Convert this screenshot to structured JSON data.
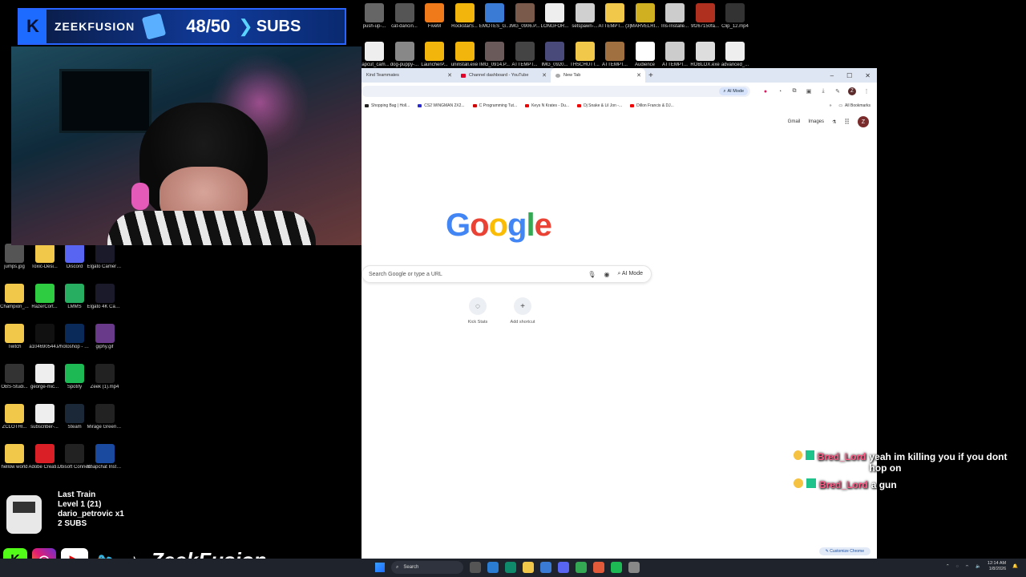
{
  "overlay": {
    "logo_letter": "K",
    "channel": "ZEEKFUSION",
    "sub_goal": "48/50",
    "subs_label": "SUBS"
  },
  "desktop_top_icons": [
    {
      "label": "push-up-...",
      "color": "#666"
    },
    {
      "label": "cat-dancin...",
      "color": "#555"
    },
    {
      "label": "FiveM",
      "color": "#f07a1a"
    },
    {
      "label": "RockstarS...",
      "color": "#f2b50c"
    },
    {
      "label": "EMOTES_G...",
      "color": "#3a7bd5"
    },
    {
      "label": "IMG_0906.P...",
      "color": "#7a5a4a"
    },
    {
      "label": "LONGFOR...",
      "color": "#eee"
    },
    {
      "label": "setspawn-...",
      "color": "#d0d0d0"
    },
    {
      "label": "ATTEMPT... (3)",
      "color": "#f2c84b"
    },
    {
      "label": "MARVELRI...",
      "color": "#d0b020"
    },
    {
      "label": "Iris-Installe...",
      "color": "#ccc"
    },
    {
      "label": "9f267150fa...",
      "color": "#b03020"
    },
    {
      "label": "Clip_12.mp4",
      "color": "#333"
    }
  ],
  "desktop_top_icons_row2": [
    {
      "label": "capcut_cam...",
      "color": "#eee"
    },
    {
      "label": "dog-puppy-...",
      "color": "#888"
    },
    {
      "label": "LauncherP...",
      "color": "#f2b50c"
    },
    {
      "label": "uninstall.exe",
      "color": "#f2b50c"
    },
    {
      "label": "IMG_0914.P...",
      "color": "#6a5a5a"
    },
    {
      "label": "ATTEMPT...",
      "color": "#444"
    },
    {
      "label": "IMG_0920...",
      "color": "#4a4a7a"
    },
    {
      "label": "THSCHUTT...",
      "color": "#f2c84b"
    },
    {
      "label": "ATTEMPT...",
      "color": "#a07040"
    },
    {
      "label": "Audience",
      "color": "#fff"
    },
    {
      "label": "ATTEMPT...",
      "color": "#ccc"
    },
    {
      "label": "ROBLOX.exe",
      "color": "#ddd"
    },
    {
      "label": "advanced_...",
      "color": "#eee"
    }
  ],
  "desktop_left_icons": [
    [
      {
        "label": "jumps.jpg",
        "color": "#555"
      },
      {
        "label": "Toxic-Desi...",
        "color": "#f2c84b"
      },
      {
        "label": "Discord",
        "color": "#5865f2"
      },
      {
        "label": "Elgato Camera Hub",
        "color": "#1a1a2a"
      }
    ],
    [
      {
        "label": "Champion_...",
        "color": "#f2c84b"
      },
      {
        "label": "RazerCort...",
        "color": "#2ecc40"
      },
      {
        "label": "LMMS",
        "color": "#27ae60"
      },
      {
        "label": "Elgato 4K Captur...",
        "color": "#1a1a2a"
      }
    ],
    [
      {
        "label": "Twitch",
        "color": "#f2c84b"
      },
      {
        "label": "a104690544...",
        "color": "#111"
      },
      {
        "label": "Photoshop - Shortcut",
        "color": "#0a2a5a"
      },
      {
        "label": "giphy.gif",
        "color": "#6a3a8a"
      }
    ],
    [
      {
        "label": "OBS-Studi...",
        "color": "#333"
      },
      {
        "label": "george-mic...",
        "color": "#eee"
      },
      {
        "label": "Spotify",
        "color": "#1db954"
      },
      {
        "label": "Zeek (1).mp4",
        "color": "#222"
      }
    ],
    [
      {
        "label": "ZCLOTHI...",
        "color": "#f2c84b"
      },
      {
        "label": "subscriber-...",
        "color": "#eee"
      },
      {
        "label": "Steam",
        "color": "#1b2838"
      },
      {
        "label": "Mirage Green Gaming Str...",
        "color": "#222"
      }
    ],
    [
      {
        "label": "hellow world",
        "color": "#f2c84b"
      },
      {
        "label": "Adobe Creati...",
        "color": "#da1f26"
      },
      {
        "label": "Ubisoft Connect",
        "color": "#222"
      },
      {
        "label": "Snapchat Installer.exe",
        "color": "#1a4aa0"
      }
    ]
  ],
  "browser": {
    "tabs": [
      {
        "label": "Kind Teammates"
      },
      {
        "label": "Channel dashboard - YouTube"
      },
      {
        "label": "New Tab"
      }
    ],
    "new_tab_symbol": "+",
    "window_controls": [
      "–",
      "☐",
      "✕"
    ],
    "ai_mode_chip": "AI Mode",
    "bookmarks": [
      {
        "label": "Shopping Bag | Holl..."
      },
      {
        "label": "CS2 WINGMAN 2X2..."
      },
      {
        "label": "C Programming Tut..."
      },
      {
        "label": "Keys N Krates - Du..."
      },
      {
        "label": "Dj Snake & Lil Jon -..."
      },
      {
        "label": "Dillon Francis & DJ..."
      }
    ],
    "all_bookmarks": "All Bookmarks",
    "gmail": "Gmail",
    "images": "Images",
    "avatar_letter": "Z",
    "google_logo": "Google",
    "search_placeholder": "Search Google or type a URL",
    "search_ai_mode": "AI Mode",
    "shortcuts": [
      {
        "label": "Kick Stats",
        "symbol": "◌"
      },
      {
        "label": "Add shortcut",
        "symbol": "+"
      }
    ],
    "customize": "Customize Chrome"
  },
  "chat": [
    {
      "user": "Bred_Lord",
      "message": "yeah im killing you if you dont hop on"
    },
    {
      "user": "Bred_Lord",
      "message": "a gun"
    }
  ],
  "last_train": {
    "title": "Last Train",
    "level": "Level 1  (21)",
    "user": "dario_petrovic x1",
    "subs": "2 SUBS"
  },
  "social": {
    "handle": "ZeekFusion"
  },
  "taskbar": {
    "search": "Search",
    "time": "12:14 AM",
    "date": "1/8/2026"
  }
}
